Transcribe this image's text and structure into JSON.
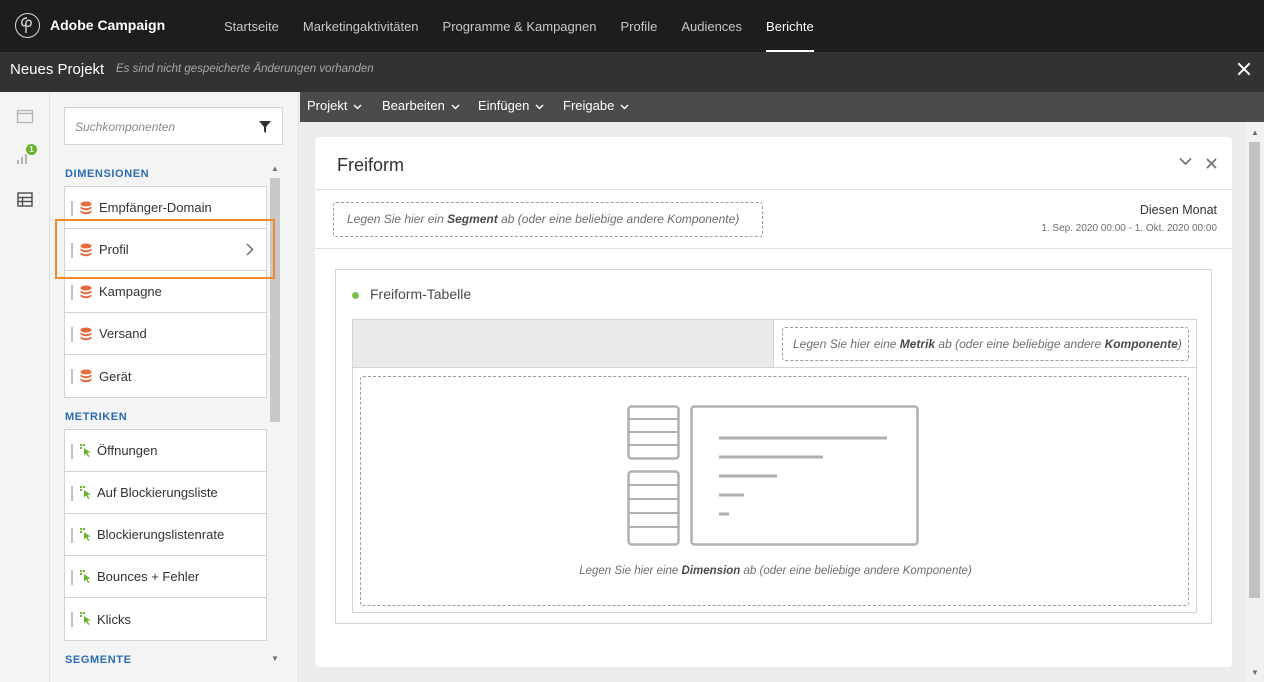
{
  "app": {
    "brand": "Adobe Campaign",
    "nav": [
      {
        "label": "Startseite",
        "active": false
      },
      {
        "label": "Marketingaktivitäten",
        "active": false
      },
      {
        "label": "Programme & Kampagnen",
        "active": false
      },
      {
        "label": "Profile",
        "active": false
      },
      {
        "label": "Audiences",
        "active": false
      },
      {
        "label": "Berichte",
        "active": true
      }
    ]
  },
  "project": {
    "title": "Neues Projekt",
    "status": "Es sind nicht gespeicherte Änderungen vorhanden"
  },
  "rail": {
    "badge": "1"
  },
  "components": {
    "search_placeholder": "Suchkomponenten",
    "dimensions_title": "DIMENSIONEN",
    "dimensions": [
      {
        "label": "Empfänger-Domain"
      },
      {
        "label": "Profil"
      },
      {
        "label": "Kampagne"
      },
      {
        "label": "Versand"
      },
      {
        "label": "Gerät"
      }
    ],
    "metrics_title": "METRIKEN",
    "metrics": [
      {
        "label": "Öffnungen"
      },
      {
        "label": "Auf Blockierungsliste"
      },
      {
        "label": "Blockierungslistenrate"
      },
      {
        "label": "Bounces + Fehler"
      },
      {
        "label": "Klicks"
      }
    ],
    "segments_title": "SEGMENTE"
  },
  "toolbar": {
    "menus": [
      "Projekt",
      "Bearbeiten",
      "Einfügen",
      "Freigabe"
    ]
  },
  "freeform": {
    "title": "Freiform",
    "segment_drop": {
      "pre": "Legen Sie hier ein ",
      "bold": "Segment",
      "post": " ab (oder eine beliebige andere Komponente)"
    },
    "range_label": "Diesen Monat",
    "range_dates": "1. Sep. 2020 00:00 - 1. Okt. 2020 00:00",
    "panel_name": "Freiform-Tabelle",
    "metric_drop": {
      "pre": "Legen Sie hier eine ",
      "bold": "Metrik",
      "post": " ab (oder eine beliebige andere ",
      "bold2": "Komponente",
      "post2": ")"
    },
    "dimension_drop": {
      "pre": "Legen Sie hier eine ",
      "bold": "Dimension",
      "post": " ab (oder eine beliebige andere Komponente)"
    }
  },
  "colors": {
    "accent_highlight": "#f08a2c",
    "section_title": "#2c6bb3",
    "status_dot": "#7cc04a",
    "dimension_icon": "#e8693d",
    "metric_icon": "#6ab42d"
  }
}
